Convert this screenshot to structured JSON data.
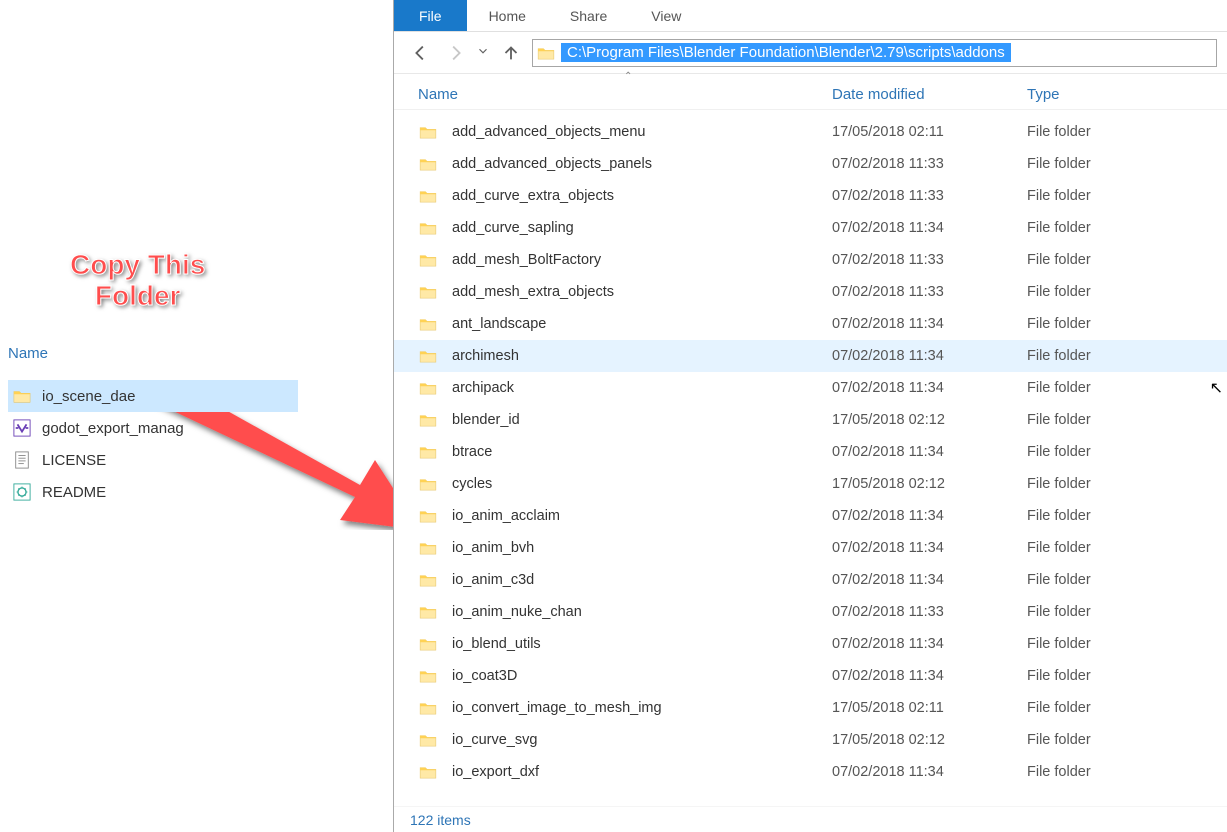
{
  "annotation": {
    "line1": "Copy This",
    "line2": "Folder"
  },
  "left": {
    "header_name": "Name",
    "items": [
      {
        "name": "io_scene_dae",
        "icon": "folder",
        "selected": true
      },
      {
        "name": "godot_export_manag",
        "icon": "vs",
        "selected": false
      },
      {
        "name": "LICENSE",
        "icon": "text",
        "selected": false
      },
      {
        "name": "README",
        "icon": "config",
        "selected": false
      }
    ]
  },
  "right": {
    "tabs": {
      "file": "File",
      "home": "Home",
      "share": "Share",
      "view": "View"
    },
    "address": "C:\\Program Files\\Blender Foundation\\Blender\\2.79\\scripts\\addons",
    "columns": {
      "name": "Name",
      "date": "Date modified",
      "type": "Type"
    },
    "folder_type_label": "File folder",
    "files": [
      {
        "name": "add_advanced_objects_menu",
        "date": "17/05/2018 02:11",
        "hovered": false
      },
      {
        "name": "add_advanced_objects_panels",
        "date": "07/02/2018 11:33",
        "hovered": false
      },
      {
        "name": "add_curve_extra_objects",
        "date": "07/02/2018 11:33",
        "hovered": false
      },
      {
        "name": "add_curve_sapling",
        "date": "07/02/2018 11:34",
        "hovered": false
      },
      {
        "name": "add_mesh_BoltFactory",
        "date": "07/02/2018 11:33",
        "hovered": false
      },
      {
        "name": "add_mesh_extra_objects",
        "date": "07/02/2018 11:33",
        "hovered": false
      },
      {
        "name": "ant_landscape",
        "date": "07/02/2018 11:34",
        "hovered": false
      },
      {
        "name": "archimesh",
        "date": "07/02/2018 11:34",
        "hovered": true
      },
      {
        "name": "archipack",
        "date": "07/02/2018 11:34",
        "hovered": false
      },
      {
        "name": "blender_id",
        "date": "17/05/2018 02:12",
        "hovered": false
      },
      {
        "name": "btrace",
        "date": "07/02/2018 11:34",
        "hovered": false
      },
      {
        "name": "cycles",
        "date": "17/05/2018 02:12",
        "hovered": false
      },
      {
        "name": "io_anim_acclaim",
        "date": "07/02/2018 11:34",
        "hovered": false
      },
      {
        "name": "io_anim_bvh",
        "date": "07/02/2018 11:34",
        "hovered": false
      },
      {
        "name": "io_anim_c3d",
        "date": "07/02/2018 11:34",
        "hovered": false
      },
      {
        "name": "io_anim_nuke_chan",
        "date": "07/02/2018 11:33",
        "hovered": false
      },
      {
        "name": "io_blend_utils",
        "date": "07/02/2018 11:34",
        "hovered": false
      },
      {
        "name": "io_coat3D",
        "date": "07/02/2018 11:34",
        "hovered": false
      },
      {
        "name": "io_convert_image_to_mesh_img",
        "date": "17/05/2018 02:11",
        "hovered": false
      },
      {
        "name": "io_curve_svg",
        "date": "17/05/2018 02:12",
        "hovered": false
      },
      {
        "name": "io_export_dxf",
        "date": "07/02/2018 11:34",
        "hovered": false
      }
    ],
    "status": "122 items"
  }
}
